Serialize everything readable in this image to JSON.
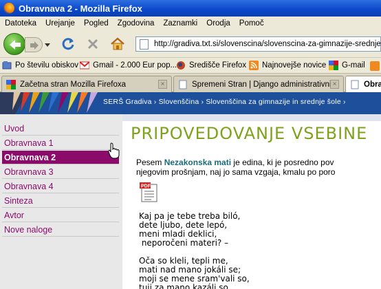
{
  "window": {
    "title": "Obravnava 2 - Mozilla Firefox"
  },
  "menu": [
    "Datoteka",
    "Urejanje",
    "Pogled",
    "Zgodovina",
    "Zaznamki",
    "Orodja",
    "Pomoč"
  ],
  "address": {
    "url": "http://gradiva.txt.si/slovenscina/slovenscina-za-gimnazije-srednje-s"
  },
  "bookmarks": [
    {
      "label": "Po številu obiskov",
      "icon": "bookmark-folder-icon"
    },
    {
      "label": "Gmail - 2.000 Eur pop...",
      "icon": "gmail-icon"
    },
    {
      "label": "Središče Firefox",
      "icon": "firefox-icon"
    },
    {
      "label": "Najnovejše novice",
      "icon": "rss-icon"
    },
    {
      "label": "G-mail",
      "icon": "google-icon"
    }
  ],
  "tabs": [
    {
      "label": "Začetna stran Mozilla Firefoxa",
      "active": false
    },
    {
      "label": "Spremeni Stran | Django administrativni...",
      "active": false
    },
    {
      "label": "Obra",
      "active": true
    }
  ],
  "breadcrumb": "SERŠ Gradiva  ›  Slovenščina  ›  Slovenščina za gimnazije in srednje šole  ›",
  "sidebar": {
    "items": [
      {
        "label": "Uvod",
        "active": false
      },
      {
        "label": "Obravnava 1",
        "active": false
      },
      {
        "label": "Obravnava 2",
        "active": true
      },
      {
        "label": "Obravnava 3",
        "active": false
      },
      {
        "label": "Obravnava 4",
        "active": false
      },
      {
        "label": "Sinteza",
        "active": false
      },
      {
        "label": "Avtor",
        "active": false
      },
      {
        "label": "Nove naloge",
        "active": false
      }
    ]
  },
  "content": {
    "title": "PRIPOVEDOVANJE VSEBINE",
    "intro_pre": "Pesem ",
    "intro_link": "Nezakonska mati",
    "intro_post": " je edina, ki je posredno pov",
    "intro_line2": "njegovim prošnjam, naj jo sama vzgaja, kmalu po poro",
    "poem": "Kaj pa je tebe treba biló,\ndete ljubo, dete lepó,\nmeni mladi deklici,\n neporočeni materi? –\n\nOča so kleli, tepli me,\nmati nad mano jokáli se;\nmoji se mene sram'vali so,\ntuji za mano kazáli so."
  },
  "colors": {
    "accent": "#8b0b6b",
    "title": "#7ea21c",
    "banner": "#1e4f9a"
  }
}
